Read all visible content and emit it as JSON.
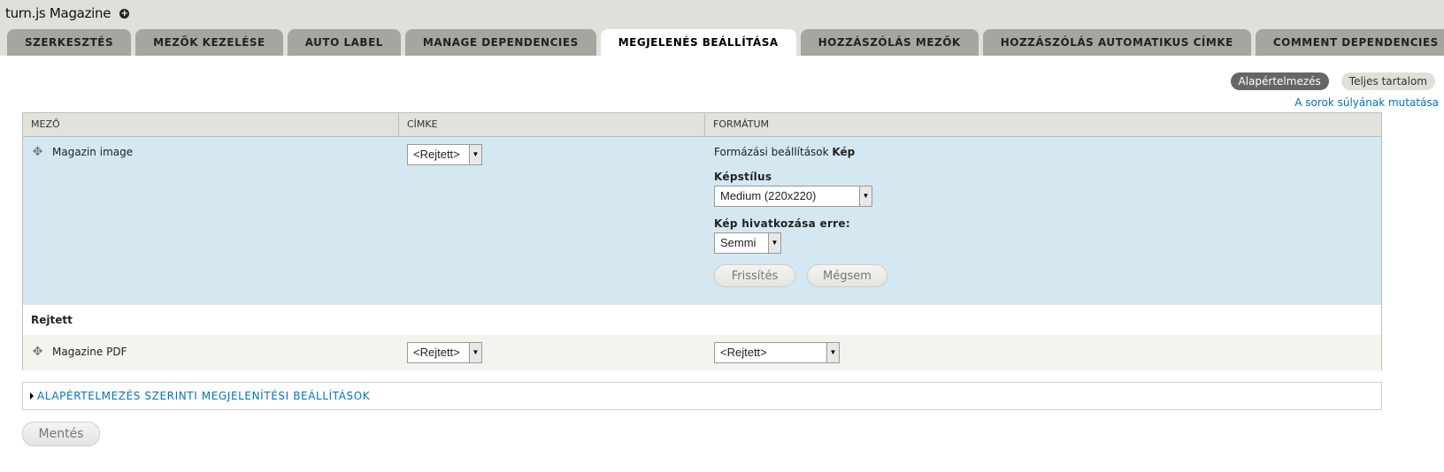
{
  "site": {
    "title": "turn.js Magazine"
  },
  "tabs": [
    {
      "label": "SZERKESZTÉS",
      "active": false
    },
    {
      "label": "MEZŐK KEZELÉSE",
      "active": false
    },
    {
      "label": "AUTO LABEL",
      "active": false
    },
    {
      "label": "MANAGE DEPENDENCIES",
      "active": false
    },
    {
      "label": "MEGJELENÉS BEÁLLÍTÁSA",
      "active": true
    },
    {
      "label": "HOZZÁSZÓLÁS MEZŐK",
      "active": false
    },
    {
      "label": "HOZZÁSZÓLÁS AUTOMATIKUS CÍMKE",
      "active": false
    },
    {
      "label": "COMMENT DEPENDENCIES",
      "active": false
    }
  ],
  "subtabs": [
    {
      "label": "Alapértelmezés",
      "active": true
    },
    {
      "label": "Teljes tartalom",
      "active": false
    }
  ],
  "weights_link": "A sorok súlyának mutatása",
  "table": {
    "headers": [
      "MEZŐ",
      "CÍMKE",
      "FORMÁTUM"
    ],
    "rows": [
      {
        "name": "Magazin image",
        "label_select": "<Rejtett>",
        "format_summary_prefix": "Formázási beállítások",
        "format_summary_type": "Kép",
        "image_style_label": "Képstílus",
        "image_style_value": "Medium (220x220)",
        "link_label": "Kép hivatkozása erre:",
        "link_value": "Semmi",
        "update_button": "Frissítés",
        "cancel_button": "Mégsem"
      }
    ],
    "region_hidden": "Rejtett",
    "hidden_rows": [
      {
        "name": "Magazine PDF",
        "label_select": "<Rejtett>",
        "format_select": "<Rejtett>"
      }
    ]
  },
  "fieldset": {
    "legend": "ALAPÉRTELMEZÉS SZERINTI MEGJELENÍTÉSI BEÁLLÍTÁSOK"
  },
  "save_button": "Mentés"
}
